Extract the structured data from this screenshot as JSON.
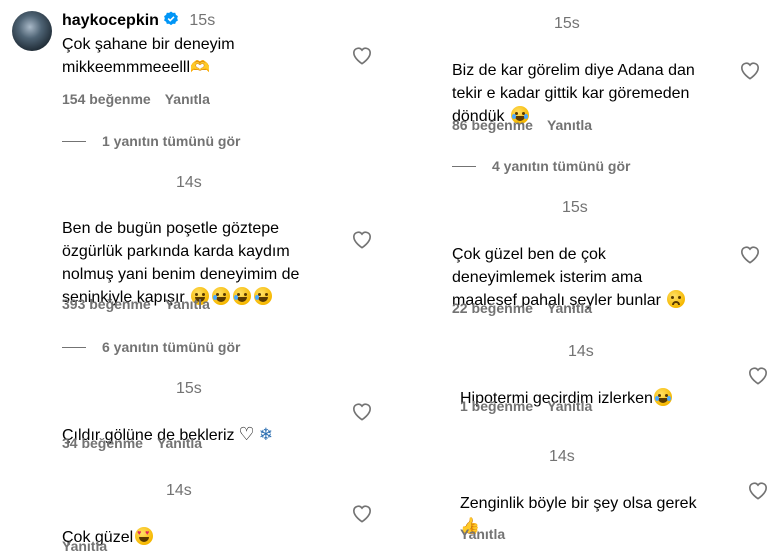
{
  "left": {
    "c1": {
      "username": "haykocepkin",
      "time": "15s",
      "text": "Çok şahane bir deneyim\nmikkeemmmeeelll🫶",
      "likes": "154 beğenme",
      "reply": "Yanıtla",
      "view_replies": "1 yanıtın tümünü gör"
    },
    "c2": {
      "time": "14s",
      "text": "Ben de bugün poşetle göztepe\nözgürlük parkında karda kaydım\nnolmuş yani benim deneyimim de\nseninkiyle kapışır",
      "likes": "393 beğenme",
      "reply": "Yanıtla",
      "view_replies": "6 yanıtın tümünü gör"
    },
    "c3": {
      "time": "15s",
      "text": "Çıldır gölüne de bekleriz",
      "likes": "34 beğenme",
      "reply": "Yanıtla"
    },
    "c4": {
      "time": "14s",
      "text": "Çok güzel",
      "reply": "Yanıtla"
    }
  },
  "right": {
    "c1": {
      "time": "15s",
      "text": "Biz de kar görelim diye Adana dan\ntekir e kadar gittik kar göremeden\ndöndük",
      "likes": "86 beğenme",
      "reply": "Yanıtla",
      "view_replies": "4 yanıtın tümünü gör"
    },
    "c2": {
      "time": "15s",
      "text": "Çok güzel ben de çok\ndeneyimlemek isterim ama\nmaalesef pahalı şeyler bunlar",
      "likes": "22 beğenme",
      "reply": "Yanıtla"
    },
    "c3": {
      "time": "14s",
      "text": "Hipotermi gecirdim izlerken",
      "likes": "1 beğenme",
      "reply": "Yanıtla"
    },
    "c4": {
      "time": "14s",
      "text": "Zenginlik böyle bir şey olsa gerek",
      "reply": "Yanıtla"
    }
  },
  "icons": {
    "like": "heart-outline-icon",
    "verified": "verified-badge-icon",
    "verified_color": "#0095f6"
  },
  "colors": {
    "secondary_text": "#737373",
    "primary_text": "#000000"
  }
}
